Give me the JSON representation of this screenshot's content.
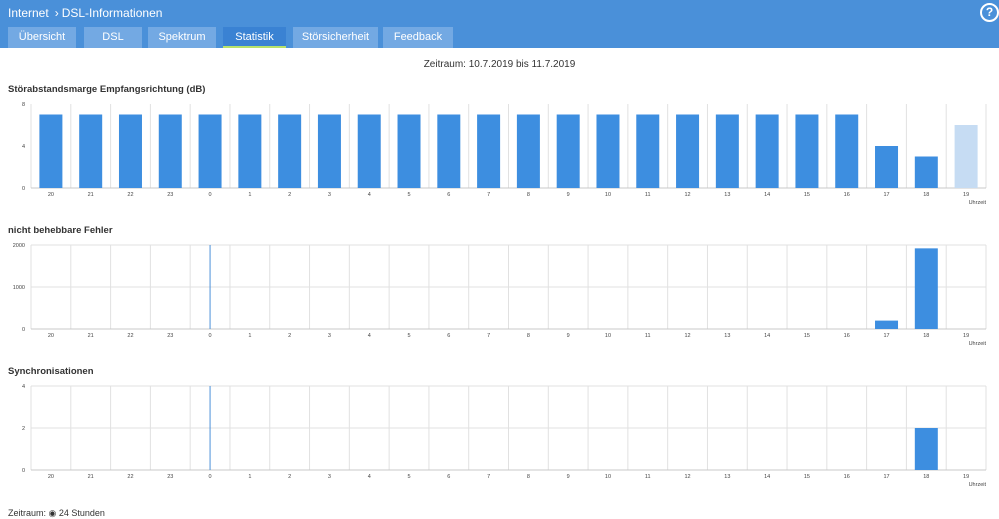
{
  "header": {
    "crumb_parent": "Internet",
    "crumb_separator": "›",
    "crumb_current": "DSL-Informationen",
    "help_label": "?"
  },
  "tabs": [
    {
      "label": "Übersicht",
      "active": false
    },
    {
      "label": "DSL",
      "active": false
    },
    {
      "label": "Spektrum",
      "active": false
    },
    {
      "label": "Statistik",
      "active": true
    },
    {
      "label": "Störsicherheit",
      "active": false
    },
    {
      "label": "Feedback",
      "active": false
    }
  ],
  "period": "Zeitraum: 10.7.2019 bis 11.7.2019",
  "colors": {
    "header": "#4a90d9",
    "tab": "#73a9e3",
    "tab_active": "#3a82d3",
    "tab_active_underline": "#b7e26b",
    "bar": "#3d8ee0",
    "bar_partial": "#c6dcf3",
    "midnight_line": "#4a90d9"
  },
  "footer": {
    "text": "Zeitraum: ◉ 24 Stunden"
  },
  "chart_data": [
    {
      "type": "bar",
      "title": "Störabstandsmarge Empfangsrichtung (dB)",
      "categories": [
        "20",
        "21",
        "22",
        "23",
        "0",
        "1",
        "2",
        "3",
        "4",
        "5",
        "6",
        "7",
        "8",
        "9",
        "10",
        "11",
        "12",
        "13",
        "14",
        "15",
        "16",
        "17",
        "18",
        "19"
      ],
      "values": [
        7,
        7,
        7,
        7,
        7,
        7,
        7,
        7,
        7,
        7,
        7,
        7,
        7,
        7,
        7,
        7,
        7,
        7,
        7,
        7,
        7,
        4,
        3,
        6
      ],
      "partial": [
        false,
        false,
        false,
        false,
        false,
        false,
        false,
        false,
        false,
        false,
        false,
        false,
        false,
        false,
        false,
        false,
        false,
        false,
        false,
        false,
        false,
        false,
        false,
        true
      ],
      "yticks": [
        "0",
        "4",
        "8"
      ],
      "ylim": [
        0,
        8
      ],
      "xlabel": "Uhrzeit",
      "ylabel": "",
      "grid": "vertical",
      "midnight_category": null
    },
    {
      "type": "bar",
      "title": "nicht behebbare Fehler",
      "categories": [
        "20",
        "21",
        "22",
        "23",
        "0",
        "1",
        "2",
        "3",
        "4",
        "5",
        "6",
        "7",
        "8",
        "9",
        "10",
        "11",
        "12",
        "13",
        "14",
        "15",
        "16",
        "17",
        "18",
        "19"
      ],
      "values": [
        0,
        0,
        0,
        0,
        0,
        0,
        0,
        0,
        0,
        0,
        0,
        0,
        0,
        0,
        0,
        0,
        0,
        0,
        0,
        0,
        0,
        200,
        1920,
        0
      ],
      "partial": [],
      "yticks": [
        "0",
        "1000",
        "2000"
      ],
      "ylim": [
        0,
        2000
      ],
      "xlabel": "Uhrzeit",
      "ylabel": "",
      "grid": "both",
      "midnight_category": "0"
    },
    {
      "type": "bar",
      "title": "Synchronisationen",
      "categories": [
        "20",
        "21",
        "22",
        "23",
        "0",
        "1",
        "2",
        "3",
        "4",
        "5",
        "6",
        "7",
        "8",
        "9",
        "10",
        "11",
        "12",
        "13",
        "14",
        "15",
        "16",
        "17",
        "18",
        "19"
      ],
      "values": [
        0,
        0,
        0,
        0,
        0,
        0,
        0,
        0,
        0,
        0,
        0,
        0,
        0,
        0,
        0,
        0,
        0,
        0,
        0,
        0,
        0,
        0,
        2,
        0
      ],
      "partial": [],
      "yticks": [
        "0",
        "2",
        "4"
      ],
      "ylim": [
        0,
        4
      ],
      "xlabel": "Uhrzeit",
      "ylabel": "",
      "grid": "both",
      "midnight_category": "0"
    }
  ]
}
